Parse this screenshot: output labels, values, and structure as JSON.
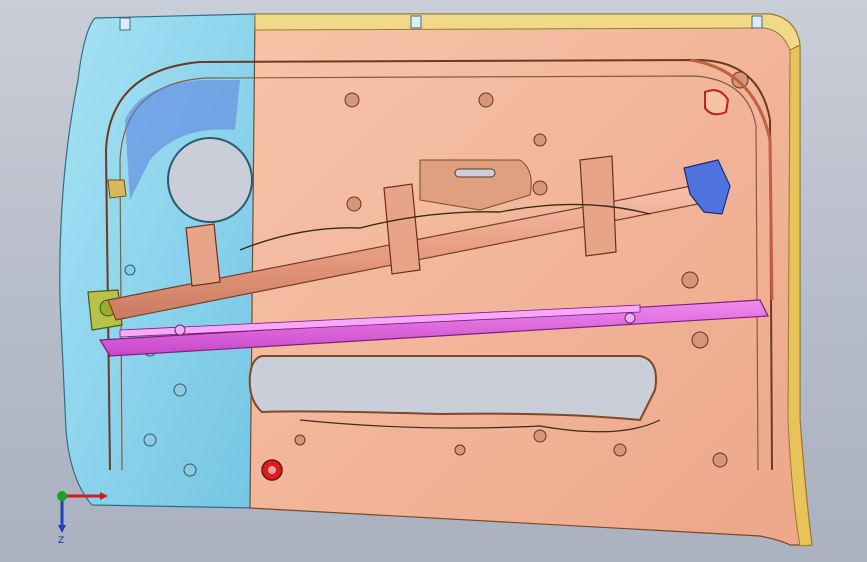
{
  "viewport": {
    "background": "#b9bfca"
  },
  "model": {
    "colors": {
      "left_panel": "#8ad6ee",
      "left_panel_edge": "#2c6f8a",
      "right_panel": "#f2b496",
      "right_panel_edge": "#7a4a2a",
      "top_rail": "#f1d98a",
      "rear_edge": "#e7c35a",
      "crossbar": "#eaa88c",
      "crossbar_edge": "#7a3d2c",
      "window_rail": "#e060e0",
      "window_rail_edge": "#7d1f7d",
      "bracket_blue": "#4f74e0",
      "bracket_green": "#b6c24a",
      "marker_red": "#d8201e"
    }
  },
  "triad": {
    "z_label": "Z",
    "x_color": "#cc2020",
    "y_color": "#20a020",
    "z_color": "#2040c0"
  }
}
